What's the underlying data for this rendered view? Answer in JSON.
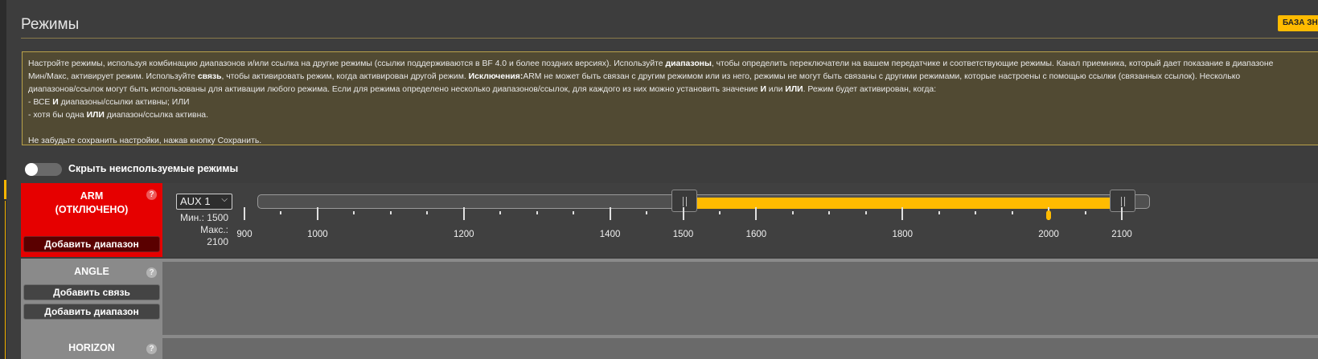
{
  "header": {
    "title": "Режимы",
    "db_button_label": "БАЗА ЗНАНИЙ"
  },
  "note": {
    "l1_a": "Настройте режимы, используя комбинацию диапазонов и/или ссылка на другие режимы (ссылки поддерживаются в BF 4.0 и более поздних версиях). Используйте ",
    "l1_b": "диапазоны",
    "l1_c": ", чтобы определить переключатели на вашем передатчике и соответствующие режимы. Канал приемника, который дает показание в диапазоне",
    "l2_a": "Мин/Макс, активирует режим. Используйте ",
    "l2_b": "связь",
    "l2_c": ", чтобы активировать режим, когда активирован другой режим. ",
    "l2_d": "Исключения:",
    "l2_e": "ARM не может быть связан с другим режимом или из него, режимы не могут быть связаны с другими режимами, которые настроены с помощью ссылки (связанных ссылок). Несколько",
    "l3_a": "диапазонов/ссылок могут быть использованы для активации любого режима. Если для режима определено несколько диапазонов/ссылок, для каждого из них можно установить значение ",
    "l3_b": "И",
    "l3_c": " или ",
    "l3_d": "ИЛИ",
    "l3_e": ". Режим будет активирован, когда:",
    "l4_a": "- ВСЕ ",
    "l4_b": "И",
    "l4_c": " диапазоны/ссылки активны; ИЛИ",
    "l5_a": "- хотя бы одна ",
    "l5_b": "ИЛИ",
    "l5_c": " диапазон/ссылка активна.",
    "l6": "Не забудьте сохранить настройки, нажав кнопку Сохранить."
  },
  "toggle": {
    "label": "Скрыть неиспользуемые режимы",
    "checked": false
  },
  "modes": {
    "arm": {
      "name_line1": "ARM",
      "name_line2": "(ОТКЛЮЧЕНО)",
      "add_range_label": "Добавить диапазон",
      "color": "#e60000",
      "range": {
        "channel": "AUX 1",
        "min_label": "Мин.: 1500",
        "max_label": "Макс.: 2100",
        "min": 1500,
        "max": 2100,
        "scale_min": 900,
        "scale_max": 2100,
        "channel_value": 2000,
        "ticks": [
          900,
          1000,
          1200,
          1400,
          1500,
          1600,
          1800,
          2000,
          2100
        ]
      }
    },
    "angle": {
      "name": "ANGLE",
      "add_link_label": "Добавить связь",
      "add_range_label": "Добавить диапазон"
    },
    "horizon": {
      "name": "HORIZON"
    }
  },
  "colors": {
    "accent": "#ffbb00",
    "disabled_mode": "#e60000"
  }
}
